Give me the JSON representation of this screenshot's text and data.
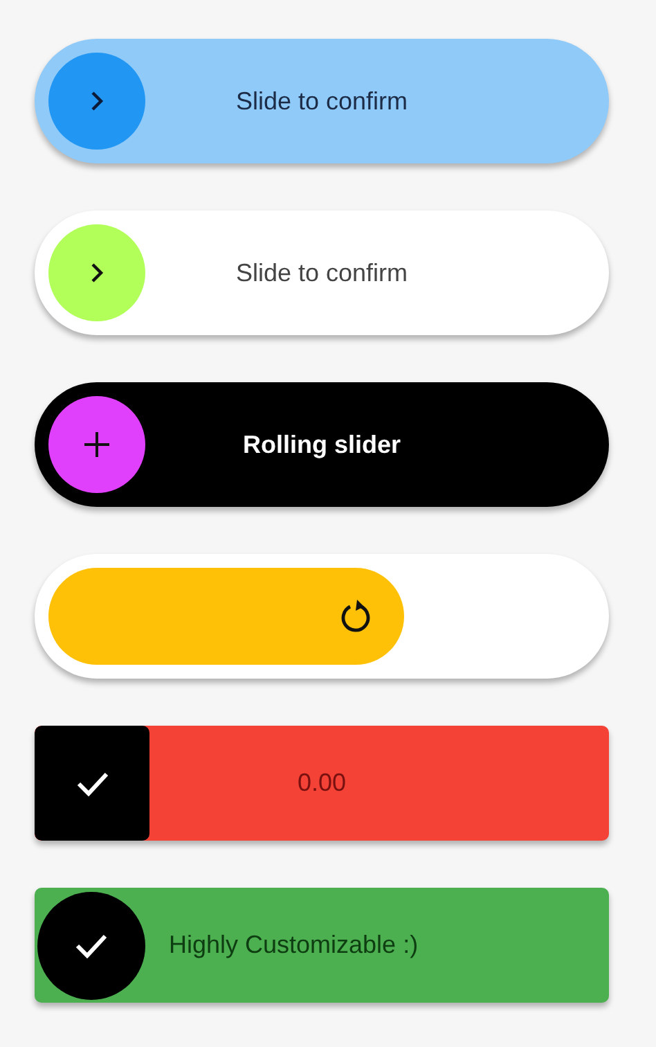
{
  "sliders": [
    {
      "kind": "pill",
      "label": "Slide to confirm",
      "color": "#90caf9",
      "level": 0
    },
    {
      "kind": "pill-white",
      "label": "Slide to confirm",
      "color": "#ffffff",
      "level": 0
    },
    {
      "kind": "rolling",
      "label": "Rolling slider",
      "color": "#000000",
      "level": 0
    },
    {
      "kind": "loading",
      "color": "#ffc107",
      "level": 0.65
    },
    {
      "kind": "square",
      "label": "0.00",
      "color": "#f44336",
      "level": 0
    },
    {
      "kind": "circle-rect",
      "label": "Highly Customizable :)",
      "color": "#4caf50",
      "level": 0
    }
  ]
}
